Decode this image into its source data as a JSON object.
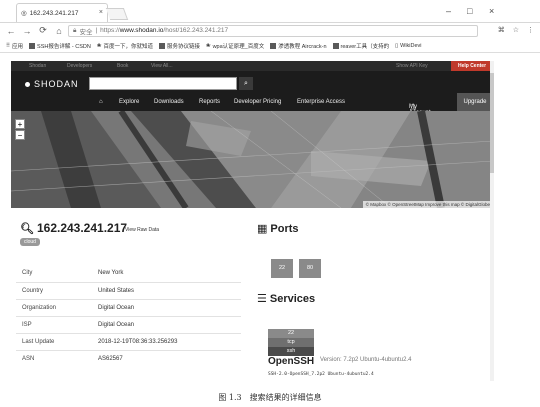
{
  "browser": {
    "tab_title": "162.243.241.217",
    "tab_close": "×",
    "url_secure": "安全",
    "url_protocol": "https://",
    "url_host": "www.shodan.io",
    "url_path": "/host/162.243.241.217",
    "window_minimize": "–",
    "window_maximize": "□",
    "window_close": "×",
    "bookmarks": [
      "应用",
      "SSH报告详解 - CSDN",
      "百度一下，你就知道",
      "服务协议链接",
      "wpa认证原理_百度文",
      "渗透教程 Aircrack-n",
      "reaver工具（支持的",
      "WikiDevi"
    ]
  },
  "shodan": {
    "topbar_links": [
      "Shodan",
      "Developers",
      "Book",
      "View All..."
    ],
    "topbar_api_key": "Show API Key",
    "help_center": "Help Center",
    "logo_text": "SHODAN",
    "search_value": "",
    "nav": [
      "Explore",
      "Downloads",
      "Reports",
      "Developer Pricing",
      "Enterprise Access"
    ],
    "my_account": "My Account",
    "upgrade": "Upgrade"
  },
  "map": {
    "zoom_in": "+",
    "zoom_out": "−",
    "attribution": "© Mapbox © OpenStreetMap Improve this map © DigitalGlobe"
  },
  "host": {
    "ip": "162.243.241.217",
    "view_raw": "View Raw Data",
    "tag": "cloud",
    "rows": [
      {
        "key": "City",
        "value": "New York"
      },
      {
        "key": "Country",
        "value": "United States"
      },
      {
        "key": "Organization",
        "value": "Digital Ocean"
      },
      {
        "key": "ISP",
        "value": "Digital Ocean"
      },
      {
        "key": "Last Update",
        "value": "2018-12-19T08:36:33.256293"
      },
      {
        "key": "ASN",
        "value": "AS62567"
      }
    ]
  },
  "ports": {
    "title": "Ports",
    "items": [
      "22",
      "80"
    ]
  },
  "services": {
    "title": "Services",
    "port": "22",
    "proto": "tcp",
    "name_tag": "ssh",
    "product": "OpenSSH",
    "version": "Version: 7.2p2 Ubuntu-4ubuntu2.4",
    "banner": "SSH-2.0-OpenSSH_7.2p2 Ubuntu-4ubuntu2.4"
  },
  "caption": "图 1.3　搜索结果的详细信息"
}
